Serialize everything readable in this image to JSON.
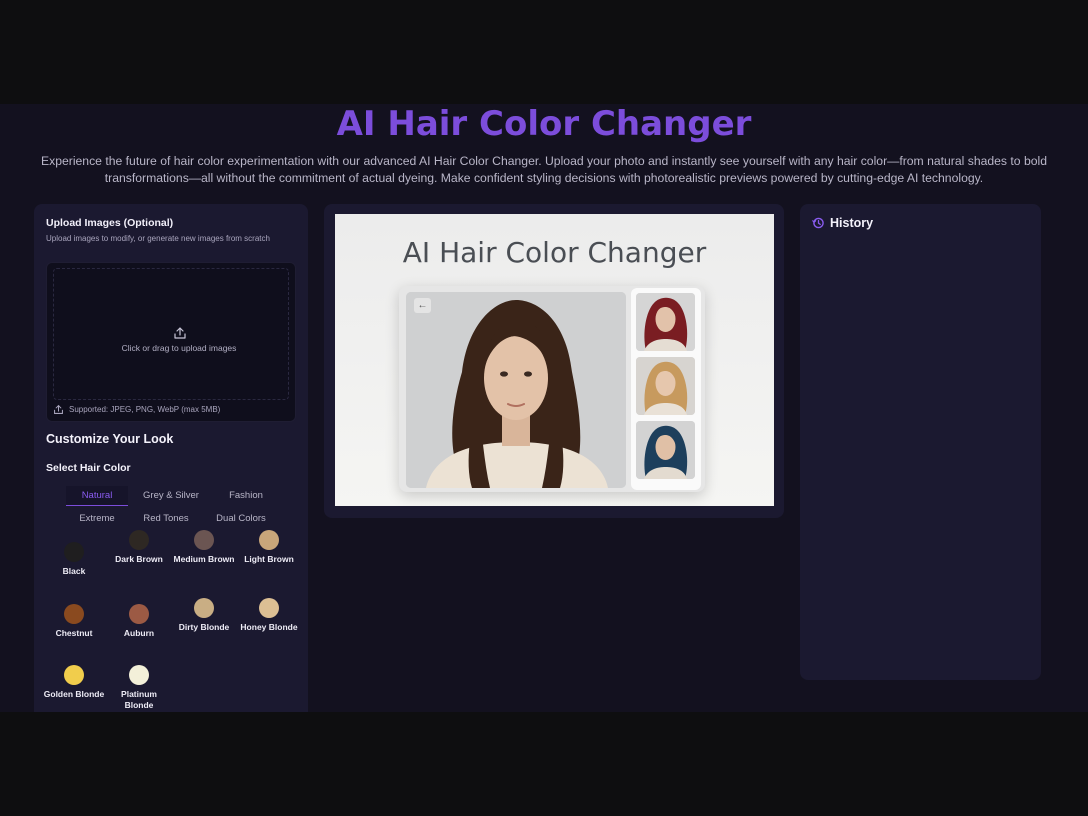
{
  "header": {
    "title": "AI Hair Color Changer",
    "subtitle": "Experience the future of hair color experimentation with our advanced AI Hair Color Changer. Upload your photo and instantly see yourself with any hair color—from natural shades to bold transformations—all without the commitment of actual dyeing. Make confident styling decisions with photorealistic previews powered by cutting-edge AI technology."
  },
  "upload": {
    "title": "Upload Images (Optional)",
    "description": "Upload images to modify, or generate new images from scratch",
    "drop_text": "Click or drag to upload images",
    "supported": "Supported: JPEG, PNG, WebP (max 5MB)",
    "icon": "upload-icon"
  },
  "customize": {
    "title": "Customize Your Look",
    "select_label": "Select Hair Color",
    "tabs": [
      "Natural",
      "Grey & Silver",
      "Fashion",
      "Extreme",
      "Red Tones",
      "Dual Colors"
    ],
    "active_tab": "Natural",
    "swatches": [
      {
        "label": "Black",
        "color": "#1f1e1f"
      },
      {
        "label": "Dark Brown",
        "color": "#2e2823"
      },
      {
        "label": "Medium Brown",
        "color": "#6b5552"
      },
      {
        "label": "Light Brown",
        "color": "#c9a67a"
      },
      {
        "label": "Chestnut",
        "color": "#8a4a1f"
      },
      {
        "label": "Auburn",
        "color": "#9c5a44"
      },
      {
        "label": "Dirty Blonde",
        "color": "#c9ae84"
      },
      {
        "label": "Honey Blonde",
        "color": "#dcbf94"
      },
      {
        "label": "Golden Blonde",
        "color": "#f1cd4c"
      },
      {
        "label": "Platinum Blonde",
        "color": "#f3f0d9"
      }
    ]
  },
  "preview": {
    "title": "AI Hair Color Changer",
    "back_icon": "arrow-left-icon"
  },
  "history": {
    "title": "History",
    "icon": "history-icon"
  },
  "colors": {
    "accent": "#7c4ddb",
    "background": "#13111f",
    "panel": "#1b1930"
  }
}
